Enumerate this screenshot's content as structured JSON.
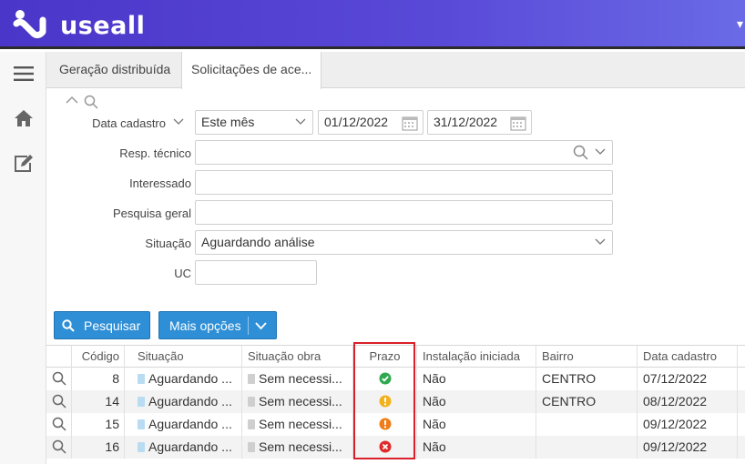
{
  "app": {
    "logo_text": "useall",
    "top_edge_glyph": "▾"
  },
  "sidebar": {
    "items": [
      {
        "name": "menu-icon"
      },
      {
        "name": "home-icon"
      },
      {
        "name": "edit-icon"
      }
    ]
  },
  "tabs": [
    {
      "label": "Geração distribuída",
      "active": false
    },
    {
      "label": "Solicitações de ace...",
      "active": true
    }
  ],
  "filters": {
    "data_cadastro": {
      "label": "Data cadastro",
      "period": "Este mês",
      "start": "01/12/2022",
      "end": "31/12/2022"
    },
    "resp_tecnico": {
      "label": "Resp. técnico",
      "value": ""
    },
    "interessado": {
      "label": "Interessado",
      "value": ""
    },
    "pesquisa_geral": {
      "label": "Pesquisa geral",
      "value": ""
    },
    "situacao": {
      "label": "Situação",
      "value": "Aguardando análise"
    },
    "uc": {
      "label": "UC",
      "value": ""
    }
  },
  "actions": {
    "search_label": "Pesquisar",
    "more_label": "Mais opções"
  },
  "table": {
    "columns": [
      "Código",
      "Situação",
      "Situação obra",
      "Prazo",
      "Instalação iniciada",
      "Bairro",
      "Data cadastro"
    ],
    "rows": [
      {
        "codigo": "8",
        "situacao": "Aguardando ...",
        "situacao_obra": "Sem necessi...",
        "prazo": "ok",
        "instalacao": "Não",
        "bairro": "CENTRO",
        "data": "07/12/2022"
      },
      {
        "codigo": "14",
        "situacao": "Aguardando ...",
        "situacao_obra": "Sem necessi...",
        "prazo": "warning",
        "instalacao": "Não",
        "bairro": "CENTRO",
        "data": "08/12/2022"
      },
      {
        "codigo": "15",
        "situacao": "Aguardando ...",
        "situacao_obra": "Sem necessi...",
        "prazo": "alert",
        "instalacao": "Não",
        "bairro": "",
        "data": "09/12/2022"
      },
      {
        "codigo": "16",
        "situacao": "Aguardando ...",
        "situacao_obra": "Sem necessi...",
        "prazo": "late",
        "instalacao": "Não",
        "bairro": "",
        "data": "09/12/2022"
      }
    ]
  },
  "colors": {
    "header_gradient_start": "#4a36c9",
    "header_gradient_end": "#6a6ae6",
    "primary": "#2e8fd6",
    "status_ok": "#2fa84f",
    "status_warning": "#f2b21c",
    "status_alert": "#ef7d1a",
    "status_late": "#e02a2a",
    "highlight": "#d9202b"
  }
}
